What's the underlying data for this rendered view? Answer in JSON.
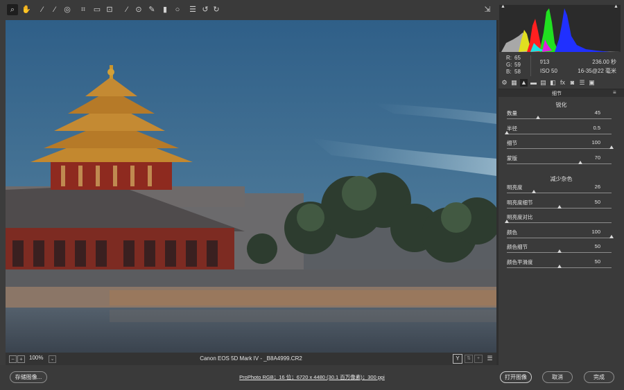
{
  "toolbar": {
    "tools": [
      {
        "name": "zoom-tool-icon",
        "glyph": "⌕",
        "active": true
      },
      {
        "name": "hand-tool-icon",
        "glyph": "✋"
      },
      {
        "name": "white-balance-tool-icon",
        "glyph": "⁄"
      },
      {
        "name": "color-sampler-tool-icon",
        "glyph": "⁄"
      },
      {
        "name": "targeted-adjustment-tool-icon",
        "glyph": "◎"
      },
      {
        "name": "crop-tool-icon",
        "glyph": "⌗"
      },
      {
        "name": "straighten-tool-icon",
        "glyph": "▭"
      },
      {
        "name": "transform-tool-icon",
        "glyph": "⊡"
      },
      {
        "name": "spot-removal-tool-icon",
        "glyph": "⁄"
      },
      {
        "name": "red-eye-tool-icon",
        "glyph": "⊙"
      },
      {
        "name": "adjustment-brush-icon",
        "glyph": "✎"
      },
      {
        "name": "graduated-filter-icon",
        "glyph": "▮"
      },
      {
        "name": "radial-filter-icon",
        "glyph": "○"
      },
      {
        "name": "preferences-icon",
        "glyph": "☰"
      },
      {
        "name": "rotate-left-icon",
        "glyph": "↺"
      },
      {
        "name": "rotate-right-icon",
        "glyph": "↻"
      }
    ],
    "export_glyph": "⇲"
  },
  "status_bar": {
    "zoom_out": "−",
    "zoom_in": "+",
    "zoom": "100%",
    "zoom_dropdown": "⌄",
    "filename": "Canon EOS 5D Mark IV -  _B8A4999.CR2",
    "view_toggle": "Y",
    "settings_glyph": "☰"
  },
  "info": {
    "r_label": "R:",
    "r_val": "65",
    "g_label": "G:",
    "g_val": "59",
    "b_label": "B:",
    "b_val": "58",
    "aperture": "f/13",
    "shutter": "236.00 秒",
    "iso": "ISO 50",
    "lens": "16-35@22 毫米"
  },
  "panel_tabs": [
    "⚙",
    "▦",
    "▲",
    "▬",
    "▤",
    "◧",
    "fx",
    "◙",
    "☰",
    "▣"
  ],
  "section_title": "细节",
  "section_menu": "≡",
  "sharpening": {
    "title": "锐化",
    "sliders": [
      {
        "label": "数量",
        "value": "45",
        "pos": 0.3
      },
      {
        "label": "半径",
        "value": "0.5",
        "pos": 0.0
      },
      {
        "label": "细节",
        "value": "100",
        "pos": 1.0
      },
      {
        "label": "蒙版",
        "value": "70",
        "pos": 0.7
      }
    ]
  },
  "noise": {
    "title": "减少杂色",
    "sliders": [
      {
        "label": "明亮度",
        "value": "26",
        "pos": 0.26
      },
      {
        "label": "明亮度细节",
        "value": "50",
        "pos": 0.5
      },
      {
        "label": "明亮度对比",
        "value": "",
        "pos": 0.0
      },
      {
        "label": "颜色",
        "value": "100",
        "pos": 1.0
      },
      {
        "label": "颜色细节",
        "value": "50",
        "pos": 0.5
      },
      {
        "label": "颜色平滑度",
        "value": "50",
        "pos": 0.5
      }
    ]
  },
  "bottom": {
    "save": "存储图像...",
    "workflow": "ProPhoto RGB；16 位；6720 x 4480 (30.1 百万像素)；300 ppi",
    "open": "打开图像",
    "cancel": "取消",
    "done": "完成"
  }
}
